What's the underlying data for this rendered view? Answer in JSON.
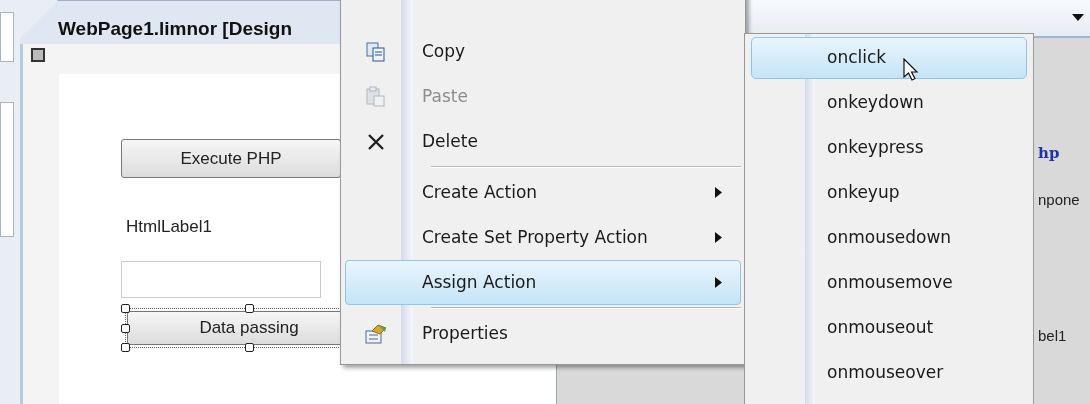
{
  "editor": {
    "tab_title": "WebPage1.limnor [Design",
    "execute_button": "Execute PHP",
    "label": "HtmlLabel1",
    "selected_button": "Data passing"
  },
  "side_panel": {
    "texts": [
      {
        "text": "hp",
        "kind": "code"
      },
      {
        "text": "npone",
        "kind": "plain"
      },
      {
        "text": "bel1",
        "kind": "plain"
      }
    ]
  },
  "context_menu": {
    "items": [
      {
        "label": "Copy",
        "kind": "copy",
        "disabled": false,
        "selected": false,
        "submenu": false
      },
      {
        "label": "Paste",
        "kind": "paste",
        "disabled": true,
        "selected": false,
        "submenu": false
      },
      {
        "label": "Delete",
        "kind": "delete",
        "disabled": false,
        "selected": false,
        "submenu": false
      },
      {
        "kind": "separator"
      },
      {
        "label": "Create Action",
        "kind": "none",
        "disabled": false,
        "selected": false,
        "submenu": true
      },
      {
        "label": "Create Set Property Action",
        "kind": "none",
        "disabled": false,
        "selected": false,
        "submenu": true
      },
      {
        "label": "Assign Action",
        "kind": "none",
        "disabled": false,
        "selected": true,
        "submenu": true
      },
      {
        "kind": "separator"
      },
      {
        "label": "Properties",
        "kind": "properties",
        "disabled": false,
        "selected": false,
        "submenu": false
      }
    ]
  },
  "submenu": {
    "items": [
      {
        "label": "onclick",
        "selected": true
      },
      {
        "label": "onkeydown",
        "selected": false
      },
      {
        "label": "onkeypress",
        "selected": false
      },
      {
        "label": "onkeyup",
        "selected": false
      },
      {
        "label": "onmousedown",
        "selected": false
      },
      {
        "label": "onmousemove",
        "selected": false
      },
      {
        "label": "onmouseout",
        "selected": false
      },
      {
        "label": "onmouseover",
        "selected": false
      }
    ]
  }
}
